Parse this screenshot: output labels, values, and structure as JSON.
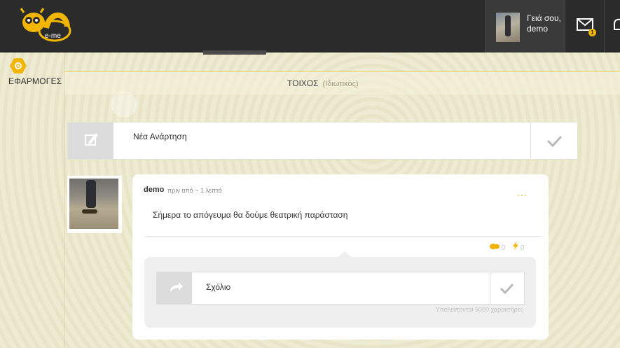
{
  "header": {
    "logo_text": "e-me",
    "greeting": "Γειά σου,",
    "username": "demo",
    "mail_badge_count": "1"
  },
  "sidebar": {
    "apps_label": "ΕΦΑΡΜΟΓΕΣ"
  },
  "page": {
    "title": "ΤΟΙΧΟΣ",
    "subtitle": "(Ιδιωτικός)"
  },
  "new_post": {
    "label": "Νέα Ανάρτηση"
  },
  "post": {
    "author": "demo",
    "time": "πριν από ~ 1 λεπτό",
    "more_label": "...",
    "text": "Σήμερα το απόγευμα θα δούμε θεατρική παράσταση",
    "comments_count": "0",
    "likes_count": "0"
  },
  "comment": {
    "label": "Σχόλιο",
    "chars_remaining": "Υπολείπονται 5000 χαρακτήρες"
  },
  "colors": {
    "accent": "#f2b600",
    "topbar": "#2b2b2b",
    "background": "#ece8cd"
  },
  "icons": [
    "logo-icon",
    "mail-icon",
    "bell-icon",
    "apps-icon",
    "edit-icon",
    "check-icon",
    "share-icon",
    "comments-icon",
    "bolt-icon"
  ]
}
